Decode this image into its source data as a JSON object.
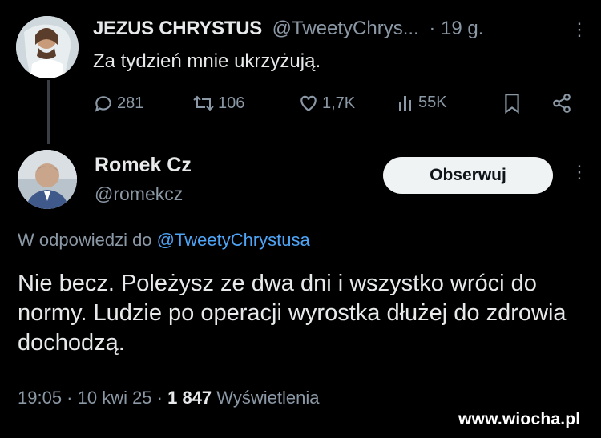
{
  "tweet1": {
    "name": "JEZUS CHRYSTUS",
    "handle": "@TweetyChrys...",
    "time": "· 19 g.",
    "more": "⋮",
    "text": "Za tydzień mnie ukrzyżują.",
    "actions": {
      "replies": "281",
      "retweets": "106",
      "likes": "1,7K",
      "views": "55K"
    },
    "icons": [
      "reply-icon",
      "retweet-icon",
      "like-icon",
      "views-icon",
      "bookmark-icon",
      "share-icon"
    ]
  },
  "tweet2": {
    "name": "Romek Cz",
    "handle": "@romekcz",
    "follow_label": "Obserwuj",
    "more": "⋮",
    "reply_prefix": "W odpowiedzi do",
    "reply_mention": "@TweetyChrystusa",
    "text": "Nie becz. Poleżysz ze dwa dni i wszystko wróci do normy. Ludzie po operacji wyrostka dłużej do zdrowia dochodzą.",
    "meta_date": "19:05 · 10 kwi 25 ·",
    "meta_views_count": "1 847",
    "meta_views_label": "Wyświetlenia"
  },
  "watermark": "www.wiocha.pl",
  "colors": {
    "background": "#000000",
    "text": "#e7e9ea",
    "muted": "#8b98a5",
    "link": "#4ea4f5",
    "button_bg": "#eff3f4"
  }
}
